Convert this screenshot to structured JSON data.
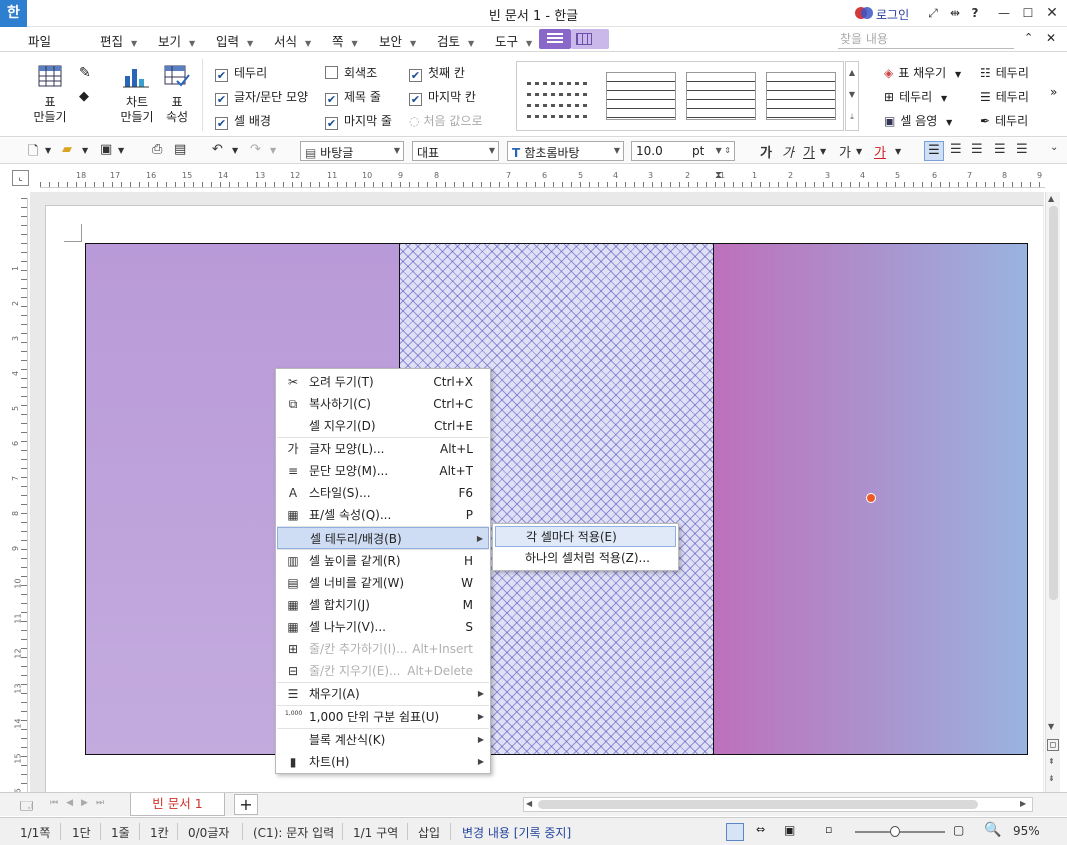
{
  "title_bar": {
    "app_icon": "한",
    "doc_title": "빈 문서 1 - 한글",
    "login": "로그인",
    "buttons": [
      "fullscreen-icon",
      "resize-icon",
      "help-icon",
      "minimize-icon",
      "maximize-icon",
      "close-icon"
    ],
    "help_glyph": "?"
  },
  "menu_bar": {
    "file": "파일",
    "items": [
      "편집",
      "보기",
      "입력",
      "서식",
      "쪽",
      "보안",
      "검토",
      "도구"
    ],
    "find_placeholder": "찾을 내용"
  },
  "ribbon": {
    "table_make": "표\n만들기",
    "chart_make": "차트\n만들기",
    "table_props": "표\n속성",
    "checks": [
      {
        "label": "테두리",
        "checked": true
      },
      {
        "label": "글자/문단 모양",
        "checked": true
      },
      {
        "label": "셀 배경",
        "checked": true
      },
      {
        "label": "회색조",
        "checked": false
      },
      {
        "label": "제목 줄",
        "checked": true
      },
      {
        "label": "마지막 줄",
        "checked": true
      },
      {
        "label": "첫째 칸",
        "checked": true
      },
      {
        "label": "마지막 칸",
        "checked": true
      },
      {
        "label": "처음 값으로",
        "checked": false,
        "disabled": true
      }
    ],
    "right_col1": [
      "표 채우기",
      "테두리",
      "셀 음영"
    ],
    "right_col2": [
      "테두리",
      "테두리",
      "테두리"
    ]
  },
  "toolbar": {
    "style_combo": "바탕글",
    "lang_combo": "대표",
    "font_combo": "함초롬바탕",
    "size_value": "10.0",
    "size_unit": "pt",
    "bold": "가",
    "italic": "가",
    "underline": "가",
    "strike": "가",
    "color": "가"
  },
  "ruler": {
    "h_ticks": [
      "18",
      "17",
      "16",
      "15",
      "14",
      "13",
      "12",
      "11",
      "10",
      "9",
      "8",
      "7",
      "6",
      "5",
      "4",
      "3",
      "2",
      "1",
      "1",
      "2",
      "3",
      "4",
      "5",
      "6",
      "7",
      "8",
      "9"
    ],
    "v_ticks": [
      "1",
      "2",
      "3",
      "4",
      "5",
      "6",
      "7",
      "8",
      "9",
      "10",
      "11",
      "12",
      "13",
      "14",
      "15",
      "16"
    ]
  },
  "context_menu": {
    "items": [
      {
        "label": "오려 두기(T)",
        "shortcut": "Ctrl+X",
        "icon": "scissors-icon",
        "glyph": "✂"
      },
      {
        "label": "복사하기(C)",
        "shortcut": "Ctrl+C",
        "icon": "copy-icon",
        "glyph": "⧉"
      },
      {
        "label": "셀 지우기(D)",
        "shortcut": "Ctrl+E",
        "icon": "",
        "glyph": ""
      },
      {
        "label": "글자 모양(L)...",
        "shortcut": "Alt+L",
        "icon": "char-shape-icon",
        "glyph": "가"
      },
      {
        "label": "문단 모양(M)...",
        "shortcut": "Alt+T",
        "icon": "para-shape-icon",
        "glyph": "≡"
      },
      {
        "label": "스타일(S)...",
        "shortcut": "F6",
        "icon": "style-icon",
        "glyph": "A"
      },
      {
        "label": "표/셀 속성(Q)...",
        "shortcut": "P",
        "icon": "table-props-icon",
        "glyph": "▦"
      },
      {
        "label": "셀 테두리/배경(B)",
        "shortcut": "",
        "icon": "",
        "glyph": "",
        "submenu": true,
        "highlight": true
      },
      {
        "label": "셀 높이를 같게(R)",
        "shortcut": "H",
        "icon": "row-height-icon",
        "glyph": "▥"
      },
      {
        "label": "셀 너비를 같게(W)",
        "shortcut": "W",
        "icon": "col-width-icon",
        "glyph": "▤"
      },
      {
        "label": "셀 합치기(J)",
        "shortcut": "M",
        "icon": "merge-cells-icon",
        "glyph": "▦"
      },
      {
        "label": "셀 나누기(V)...",
        "shortcut": "S",
        "icon": "split-cells-icon",
        "glyph": "▦"
      },
      {
        "label": "줄/칸 추가하기(I)...",
        "shortcut": "Alt+Insert",
        "icon": "insert-row-icon",
        "glyph": "⊞",
        "disabled": true
      },
      {
        "label": "줄/칸 지우기(E)...",
        "shortcut": "Alt+Delete",
        "icon": "delete-row-icon",
        "glyph": "⊟",
        "disabled": true
      },
      {
        "label": "채우기(A)",
        "shortcut": "",
        "icon": "fill-icon",
        "glyph": "☰",
        "submenu": true
      },
      {
        "label": "1,000 단위 구분 쉼표(U)",
        "shortcut": "",
        "icon": "thousands-icon",
        "glyph": "✓",
        "submenu": true,
        "tiny": "1,000"
      },
      {
        "label": "블록 계산식(K)",
        "shortcut": "",
        "icon": "",
        "glyph": "",
        "submenu": true
      },
      {
        "label": "차트(H)",
        "shortcut": "",
        "icon": "chart-icon",
        "glyph": "▮",
        "submenu": true
      }
    ]
  },
  "submenu": {
    "items": [
      "각 셀마다 적용(E)",
      "하나의 셀처럼 적용(Z)..."
    ]
  },
  "tab_bar": {
    "doc_tab": "빈 문서 1",
    "add": "+"
  },
  "status_bar": {
    "items": [
      "1/1쪽",
      "1단",
      "1줄",
      "1칸",
      "0/0글자",
      "(C1): 문자 입력",
      "1/1 구역",
      "삽입"
    ],
    "track_changes": "변경 내용 [기록 중지]",
    "zoom": "95%"
  },
  "colors": {
    "accent": "#1a4d8f",
    "cell1": "#b99ad8",
    "cell3_start": "#bd70bb",
    "cell3_end": "#9ab3e0",
    "pattern": "#5050be",
    "caret": "#f05a28",
    "tab_text": "#d0342c"
  }
}
